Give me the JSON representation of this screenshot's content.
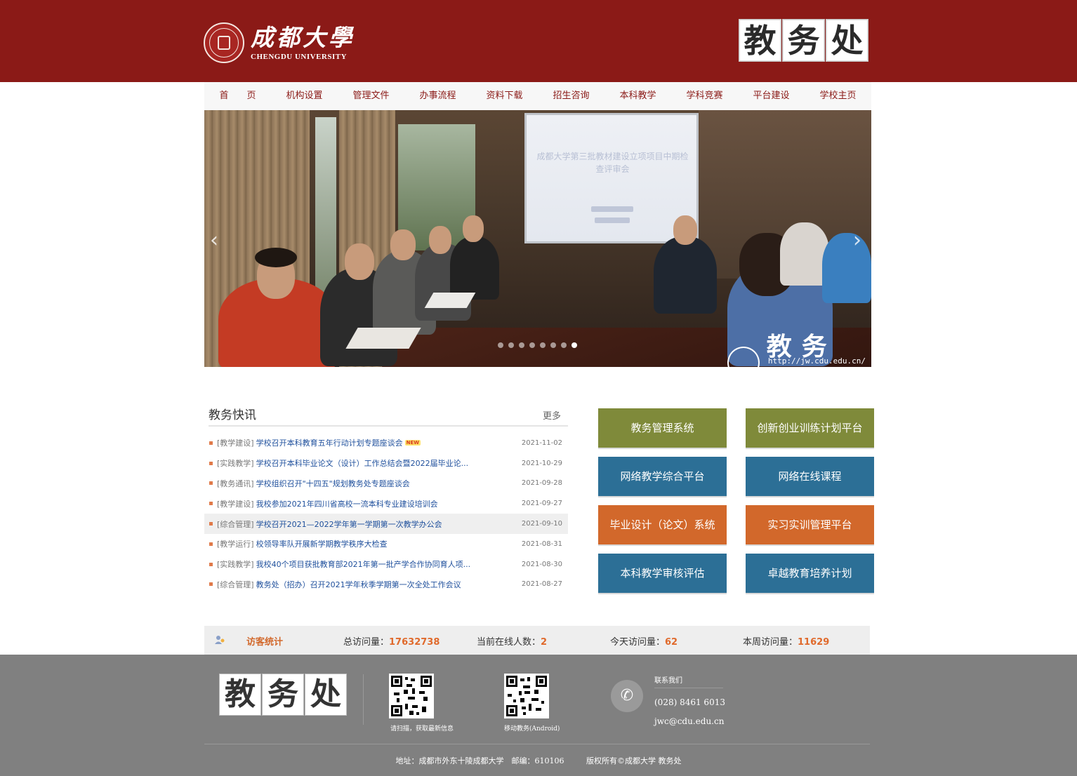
{
  "header": {
    "logo_cn": "成都大學",
    "logo_en": "CHENGDU UNIVERSITY",
    "office_chars": [
      "教",
      "务",
      "处"
    ]
  },
  "nav": [
    "首　　页",
    "机构设置",
    "管理文件",
    "办事流程",
    "资料下载",
    "招生咨询",
    "本科教学",
    "学科竞赛",
    "平台建设",
    "学校主页"
  ],
  "slider": {
    "screen_text": "成都大学第三批教材建设立项项目中期检查评审会",
    "prev": "‹",
    "next": "›",
    "watermark": "教务处",
    "url": "http://jw.cdu.edu.cn/",
    "dots_count": 8,
    "active_dot": 8
  },
  "news": {
    "title": "教务快讯",
    "more": "更多",
    "new_badge": "NEW",
    "items": [
      {
        "cat": "[教学建设]",
        "title": "学校召开本科教育五年行动计划专题座谈会",
        "date": "2021-11-02"
      },
      {
        "cat": "[实践教学]",
        "title": "学校召开本科毕业论文（设计）工作总结会暨2022届毕业论...",
        "date": "2021-10-29"
      },
      {
        "cat": "[教务通讯]",
        "title": "学校组织召开\"十四五\"规划教务处专题座谈会",
        "date": "2021-09-28"
      },
      {
        "cat": "[教学建设]",
        "title": "我校参加2021年四川省高校一流本科专业建设培训会",
        "date": "2021-09-27"
      },
      {
        "cat": "[综合管理]",
        "title": "学校召开2021—2022学年第一学期第一次教学办公会",
        "date": "2021-09-10"
      },
      {
        "cat": "[教学运行]",
        "title": "校领导率队开展新学期教学秩序大检查",
        "date": "2021-08-31"
      },
      {
        "cat": "[实践教学]",
        "title": "我校40个项目获批教育部2021年第一批产学合作协同育人项...",
        "date": "2021-08-30"
      },
      {
        "cat": "[综合管理]",
        "title": "教务处（招办）召开2021学年秋季学期第一次全处工作会议",
        "date": "2021-08-27"
      }
    ]
  },
  "quick_links": [
    {
      "label": "教务管理系统",
      "color": "#7f8a3a"
    },
    {
      "label": "创新创业训练计划平台",
      "color": "#7f8a3a"
    },
    {
      "label": "网络教学综合平台",
      "color": "#2c6f96"
    },
    {
      "label": "网络在线课程",
      "color": "#2c6f96"
    },
    {
      "label": "毕业设计（论文）系统",
      "color": "#d2682b"
    },
    {
      "label": "实习实训管理平台",
      "color": "#d2682b"
    },
    {
      "label": "本科教学审核评估",
      "color": "#2c6f96"
    },
    {
      "label": "卓越教育培养计划",
      "color": "#2c6f96"
    }
  ],
  "stats": {
    "label": "访客统计",
    "total_label": "总访问量：",
    "total": "17632738",
    "online_label": "当前在线人数：",
    "online": "2",
    "today_label": "今天访问量：",
    "today": "62",
    "week_label": "本周访问量：",
    "week": "11629"
  },
  "footer": {
    "title_chars": [
      "教",
      "务",
      "处"
    ],
    "qr1_caption": "请扫描，获取最新信息",
    "qr2_caption": "移动教务(Android)",
    "contact_title": "联系我们",
    "phone": "(028) 8461 6013",
    "email": "jwc@cdu.edu.cn",
    "address": "地址：成都市外东十陵成都大学　邮编：610106",
    "copyright": "版权所有©成都大学 教务处"
  },
  "colors": {
    "brand_red": "#8b1a17",
    "footer_gray": "#808080",
    "link_blue": "#1e4f9c",
    "stat_orange": "#e06a2c"
  }
}
